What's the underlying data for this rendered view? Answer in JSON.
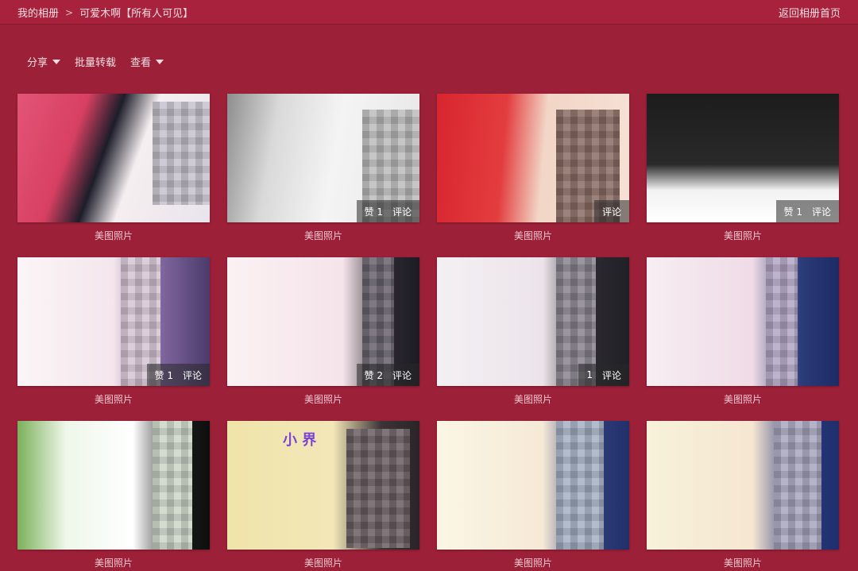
{
  "header": {
    "breadcrumb": [
      "我的相册",
      "可爱木啊【所有人可见】"
    ],
    "separator": ">",
    "back_link": "返回相册首页"
  },
  "toolbar": {
    "share_label": "分享",
    "batch_label": "批量转载",
    "view_label": "查看"
  },
  "photos": [
    {
      "caption": "美图照片",
      "likes": "",
      "comment": ""
    },
    {
      "caption": "美图照片",
      "likes": "赞 1",
      "comment": "评论"
    },
    {
      "caption": "美图照片",
      "likes": "",
      "comment": "评论"
    },
    {
      "caption": "美图照片",
      "likes": "赞 1",
      "comment": "评论"
    },
    {
      "caption": "美图照片",
      "likes": "赞 1",
      "comment": "评论"
    },
    {
      "caption": "美图照片",
      "likes": "赞 2",
      "comment": "评论"
    },
    {
      "caption": "美图照片",
      "likes": "1",
      "comment": "评论"
    },
    {
      "caption": "美图照片",
      "likes": "",
      "comment": ""
    },
    {
      "caption": "美图照片",
      "likes": "",
      "comment": ""
    },
    {
      "caption": "美图照片",
      "likes": "",
      "comment": ""
    },
    {
      "caption": "美图照片",
      "likes": "",
      "comment": ""
    },
    {
      "caption": "美图照片",
      "likes": "",
      "comment": ""
    }
  ],
  "sticker_text": "小 界",
  "colors": {
    "background": "#9c2038",
    "topbar": "#a8223d",
    "text": "#f6dfe4"
  }
}
